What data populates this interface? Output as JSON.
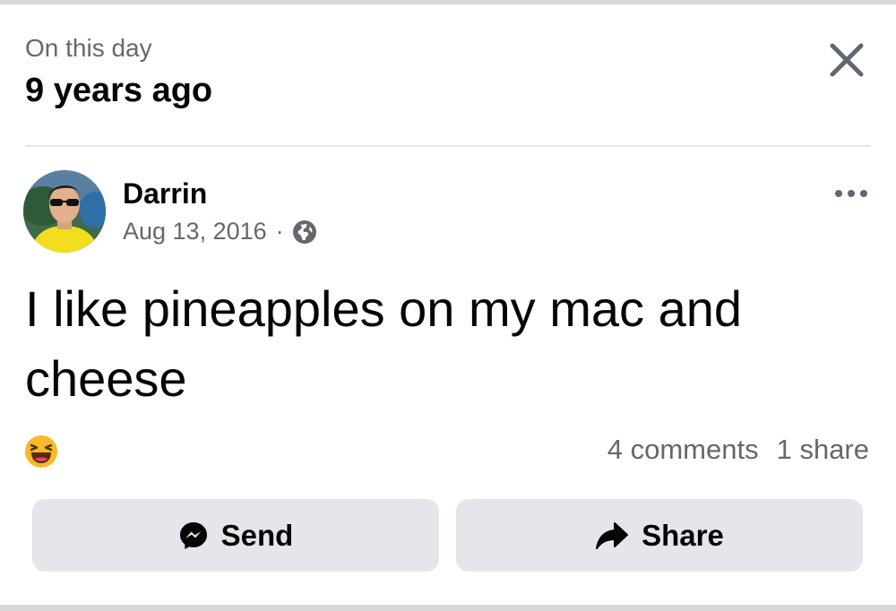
{
  "memory": {
    "label": "On this day",
    "title": "9 years ago"
  },
  "post": {
    "author": "Darrin",
    "date": "Aug 13, 2016",
    "separator": "·",
    "privacy_icon": "globe-icon",
    "text": "I like pineapples on my mac and cheese",
    "reaction_icon": "haha-reaction-icon",
    "comments": "4 comments",
    "shares": "1 share"
  },
  "actions": {
    "send_label": "Send",
    "send_icon": "messenger-icon",
    "share_label": "Share",
    "share_icon": "share-arrow-icon"
  },
  "colors": {
    "text_primary": "#050505",
    "text_secondary": "#65676b",
    "button_bg": "#e4e6eb",
    "divider": "#e4e6eb",
    "reaction_yellow": "#f7b928"
  }
}
